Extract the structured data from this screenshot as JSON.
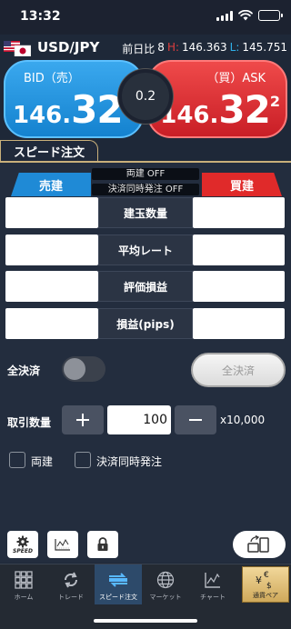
{
  "status_bar": {
    "time": "13:32"
  },
  "pair": {
    "name": "USD/JPY",
    "prev_ratio_label": "前日比",
    "prev_ratio_value": "8",
    "high_label": "H:",
    "high_value": "146.363",
    "low_label": "L:",
    "low_value": "145.751"
  },
  "bid": {
    "label": "BID（売）",
    "price_main": "146.",
    "price_big": "32",
    "price_sup": "0"
  },
  "ask": {
    "label": "（買）ASK",
    "price_main": "146.",
    "price_big": "32",
    "price_sup": "2"
  },
  "spread": "0.2",
  "speed_order": {
    "tab_label": "スピード注文",
    "sell_tab": "売建",
    "buy_tab": "買建",
    "ryodate_status": "両建 OFF",
    "settle_status": "決済同時発注 OFF",
    "rows": [
      "建玉数量",
      "平均レート",
      "評価損益",
      "損益(pips)"
    ],
    "all_settle_label": "全決済",
    "all_settle_button": "全決済",
    "qty_label": "取引数量",
    "qty_value": "100",
    "qty_unit": "x10,000",
    "check_ryodate": "両建",
    "check_settle": "決済同時発注",
    "speed_caption": "SPEED"
  },
  "tabs": {
    "home": "ホーム",
    "trade": "トレード",
    "speed": "スピード注文",
    "market": "マーケット",
    "chart": "チャート",
    "pair": "通貨ペア"
  },
  "colors": {
    "bid": "#1f8ad6",
    "ask": "#e02a2a",
    "high": "#e03e3e",
    "low": "#2fb0e8",
    "accent": "#c9b07a"
  }
}
